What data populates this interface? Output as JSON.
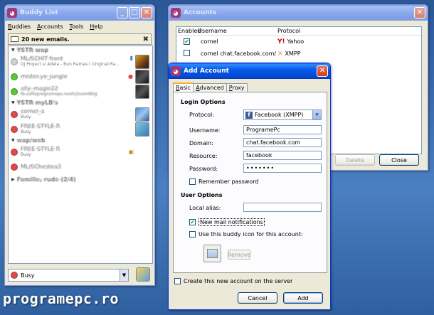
{
  "buddy_list": {
    "title": "Buddy List",
    "menu": [
      "Buddies",
      "Accounts",
      "Tools",
      "Help"
    ],
    "notice": "20 new emails.",
    "groups": [
      {
        "name": "YSTR wap",
        "buddies": [
          {
            "name": "ML/SCHIT front",
            "sub": "Dj Project si Adela - Bun Ramas ( Original Ra...",
            "status": "away"
          },
          {
            "name": "mister.yo_jungle",
            "sub": "",
            "status": "on"
          },
          {
            "name": "ally_magic22",
            "sub": "",
            "status": "on"
          }
        ]
      },
      {
        "name": "YSTR myLB's",
        "buddies": [
          {
            "name": "cornel_a",
            "sub": "Busy",
            "status": "busy"
          },
          {
            "name": "FREE STYLE R",
            "sub": "Busy",
            "status": "busy"
          }
        ]
      },
      {
        "name": "wap/web",
        "buddies": [
          {
            "name": "FREE STYLE R",
            "sub": "Busy",
            "status": "busy"
          },
          {
            "name": "ML/SChestea3",
            "sub": "",
            "status": "busy"
          }
        ]
      },
      {
        "name": "Familie, rude (2/4)",
        "buddies": []
      }
    ],
    "status_selector": "Busy"
  },
  "accounts": {
    "title": "Accounts",
    "columns": [
      "Enabled",
      "Username",
      "Protocol"
    ],
    "rows": [
      {
        "enabled": true,
        "username": "cornel",
        "protocol": "Yahoo"
      },
      {
        "enabled": false,
        "username": "cornel  chat.facebook.com/",
        "protocol": "XMPP"
      }
    ],
    "delete_label": "Delete",
    "close_label": "Close"
  },
  "add_account": {
    "title": "Add Account",
    "tabs": [
      "Basic",
      "Advanced",
      "Proxy"
    ],
    "login_options_heading": "Login Options",
    "protocol_label": "Protocol:",
    "protocol_value": "Facebook (XMPP)",
    "username_label": "Username:",
    "username_value": "ProgramePc",
    "domain_label": "Domain:",
    "domain_value": "chat.facebook.com",
    "resource_label": "Resource:",
    "resource_value": "facebook",
    "password_label": "Password:",
    "password_value": "•••••••",
    "remember_password_label": "Remember password",
    "user_options_heading": "User Options",
    "local_alias_label": "Local alias:",
    "local_alias_value": "",
    "new_mail_label": "New mail notifications",
    "buddy_icon_label": "Use this buddy icon for this account:",
    "remove_label": "Remove",
    "create_on_server_label": "Create this new account on the server",
    "cancel_label": "Cancel",
    "add_label": "Add"
  },
  "watermark": "programepc.ro",
  "colors": {
    "titlebar": "#0659e5",
    "face": "#ece9d8",
    "busy": "#e04a4a",
    "online": "#5ec23a"
  }
}
